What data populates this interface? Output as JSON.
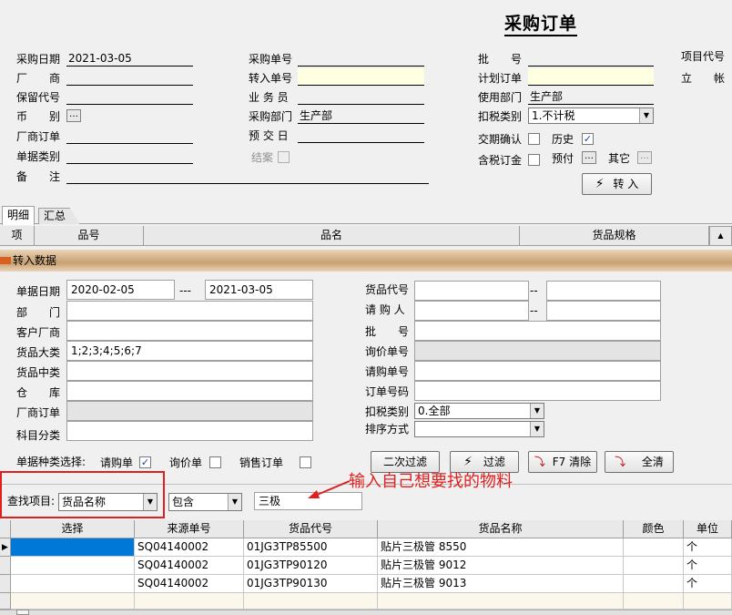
{
  "title": "采购订单",
  "header": {
    "col1": [
      {
        "label": "采购日期",
        "value": "2021-03-05"
      },
      {
        "label": "厂　　商",
        "value": ""
      },
      {
        "label": "保留代号",
        "value": ""
      },
      {
        "label": "币　　别",
        "value": ""
      },
      {
        "label": "厂商订单",
        "value": ""
      },
      {
        "label": "单据类别",
        "value": ""
      },
      {
        "label": "备　　注",
        "value": ""
      }
    ],
    "col2": [
      {
        "label": "采购单号",
        "value": ""
      },
      {
        "label": "转入单号",
        "value": ""
      },
      {
        "label": "业 务 员",
        "value": ""
      },
      {
        "label": "采购部门",
        "value": "生产部"
      },
      {
        "label": "预 交 日",
        "value": ""
      }
    ],
    "closed_label": "结案",
    "col3": [
      {
        "label": "批　　号",
        "value": ""
      },
      {
        "label": "计划订单",
        "value": ""
      },
      {
        "label": "使用部门",
        "value": "生产部"
      }
    ],
    "tax_label": "扣税类别",
    "tax_value": "1.不计税",
    "confirm_label": "交期确认",
    "history_label": "历史",
    "taxorder_label": "含税订金",
    "prepay_label": "预付",
    "other_label": "其它",
    "col4": [
      {
        "label": "项目代号"
      },
      {
        "label": "立　　帐"
      }
    ],
    "transfer_button": "转 入",
    "ellipsis": "…"
  },
  "tabs": [
    "明细",
    "汇总"
  ],
  "detail_columns": [
    "项",
    "品号",
    "品名",
    "货品规格"
  ],
  "panel": {
    "title": "转入数据",
    "left": {
      "date_label": "单据日期",
      "date_from": "2020-02-05",
      "date_sep": "---",
      "date_to": "2021-03-05",
      "rows": [
        {
          "label": "部　　门",
          "value": ""
        },
        {
          "label": "客户厂商",
          "value": ""
        },
        {
          "label": "货品大类",
          "value": "1;2;3;4;5;6;7"
        },
        {
          "label": "货品中类",
          "value": ""
        },
        {
          "label": "仓　　库",
          "value": ""
        },
        {
          "label": "厂商订单",
          "value": ""
        },
        {
          "label": "科目分类",
          "value": ""
        }
      ]
    },
    "right": {
      "code_label": "货品代号",
      "code_sep": "--",
      "requester_label": "请 购 人",
      "requester_sep": "--",
      "rows": [
        {
          "label": "批　　号",
          "value": ""
        },
        {
          "label": "询价单号",
          "value": ""
        },
        {
          "label": "请购单号",
          "value": ""
        },
        {
          "label": "订单号码",
          "value": ""
        }
      ],
      "tax_label": "扣税类别",
      "tax_value": "0.全部",
      "sort_label": "排序方式",
      "sort_value": ""
    },
    "doc_type_label": "单据种类选择:",
    "doc_types": [
      {
        "label": "请购单",
        "checked": true
      },
      {
        "label": "询价单",
        "checked": false
      },
      {
        "label": "销售订单",
        "checked": false
      }
    ],
    "buttons": {
      "refilter": "二次过滤",
      "filter": "过滤",
      "clear": "F7 清除",
      "clear_all": "全清"
    },
    "search": {
      "label": "查找项目:",
      "field": "货品名称",
      "mode": "包含",
      "keyword": "三极"
    },
    "annotation": "输入自己想要找的物料"
  },
  "results": {
    "columns": [
      "选择",
      "来源单号",
      "货品代号",
      "货品名称",
      "颜色",
      "单位"
    ],
    "rows": [
      {
        "source": "SQ04140002",
        "code": "01JG3TP85500",
        "name": "贴片三极管 8550",
        "color": "",
        "unit": "个"
      },
      {
        "source": "SQ04140002",
        "code": "01JG3TP90120",
        "name": "贴片三极管 9012",
        "color": "",
        "unit": "个"
      },
      {
        "source": "SQ04140002",
        "code": "01JG3TP90130",
        "name": "贴片三极管 9013",
        "color": "",
        "unit": "个"
      }
    ]
  },
  "colors": {
    "yellow_field": "#ffffe1",
    "highlight_red": "#e02020",
    "panel_bar": "#c8a070",
    "select_blue": "#0078d7"
  }
}
